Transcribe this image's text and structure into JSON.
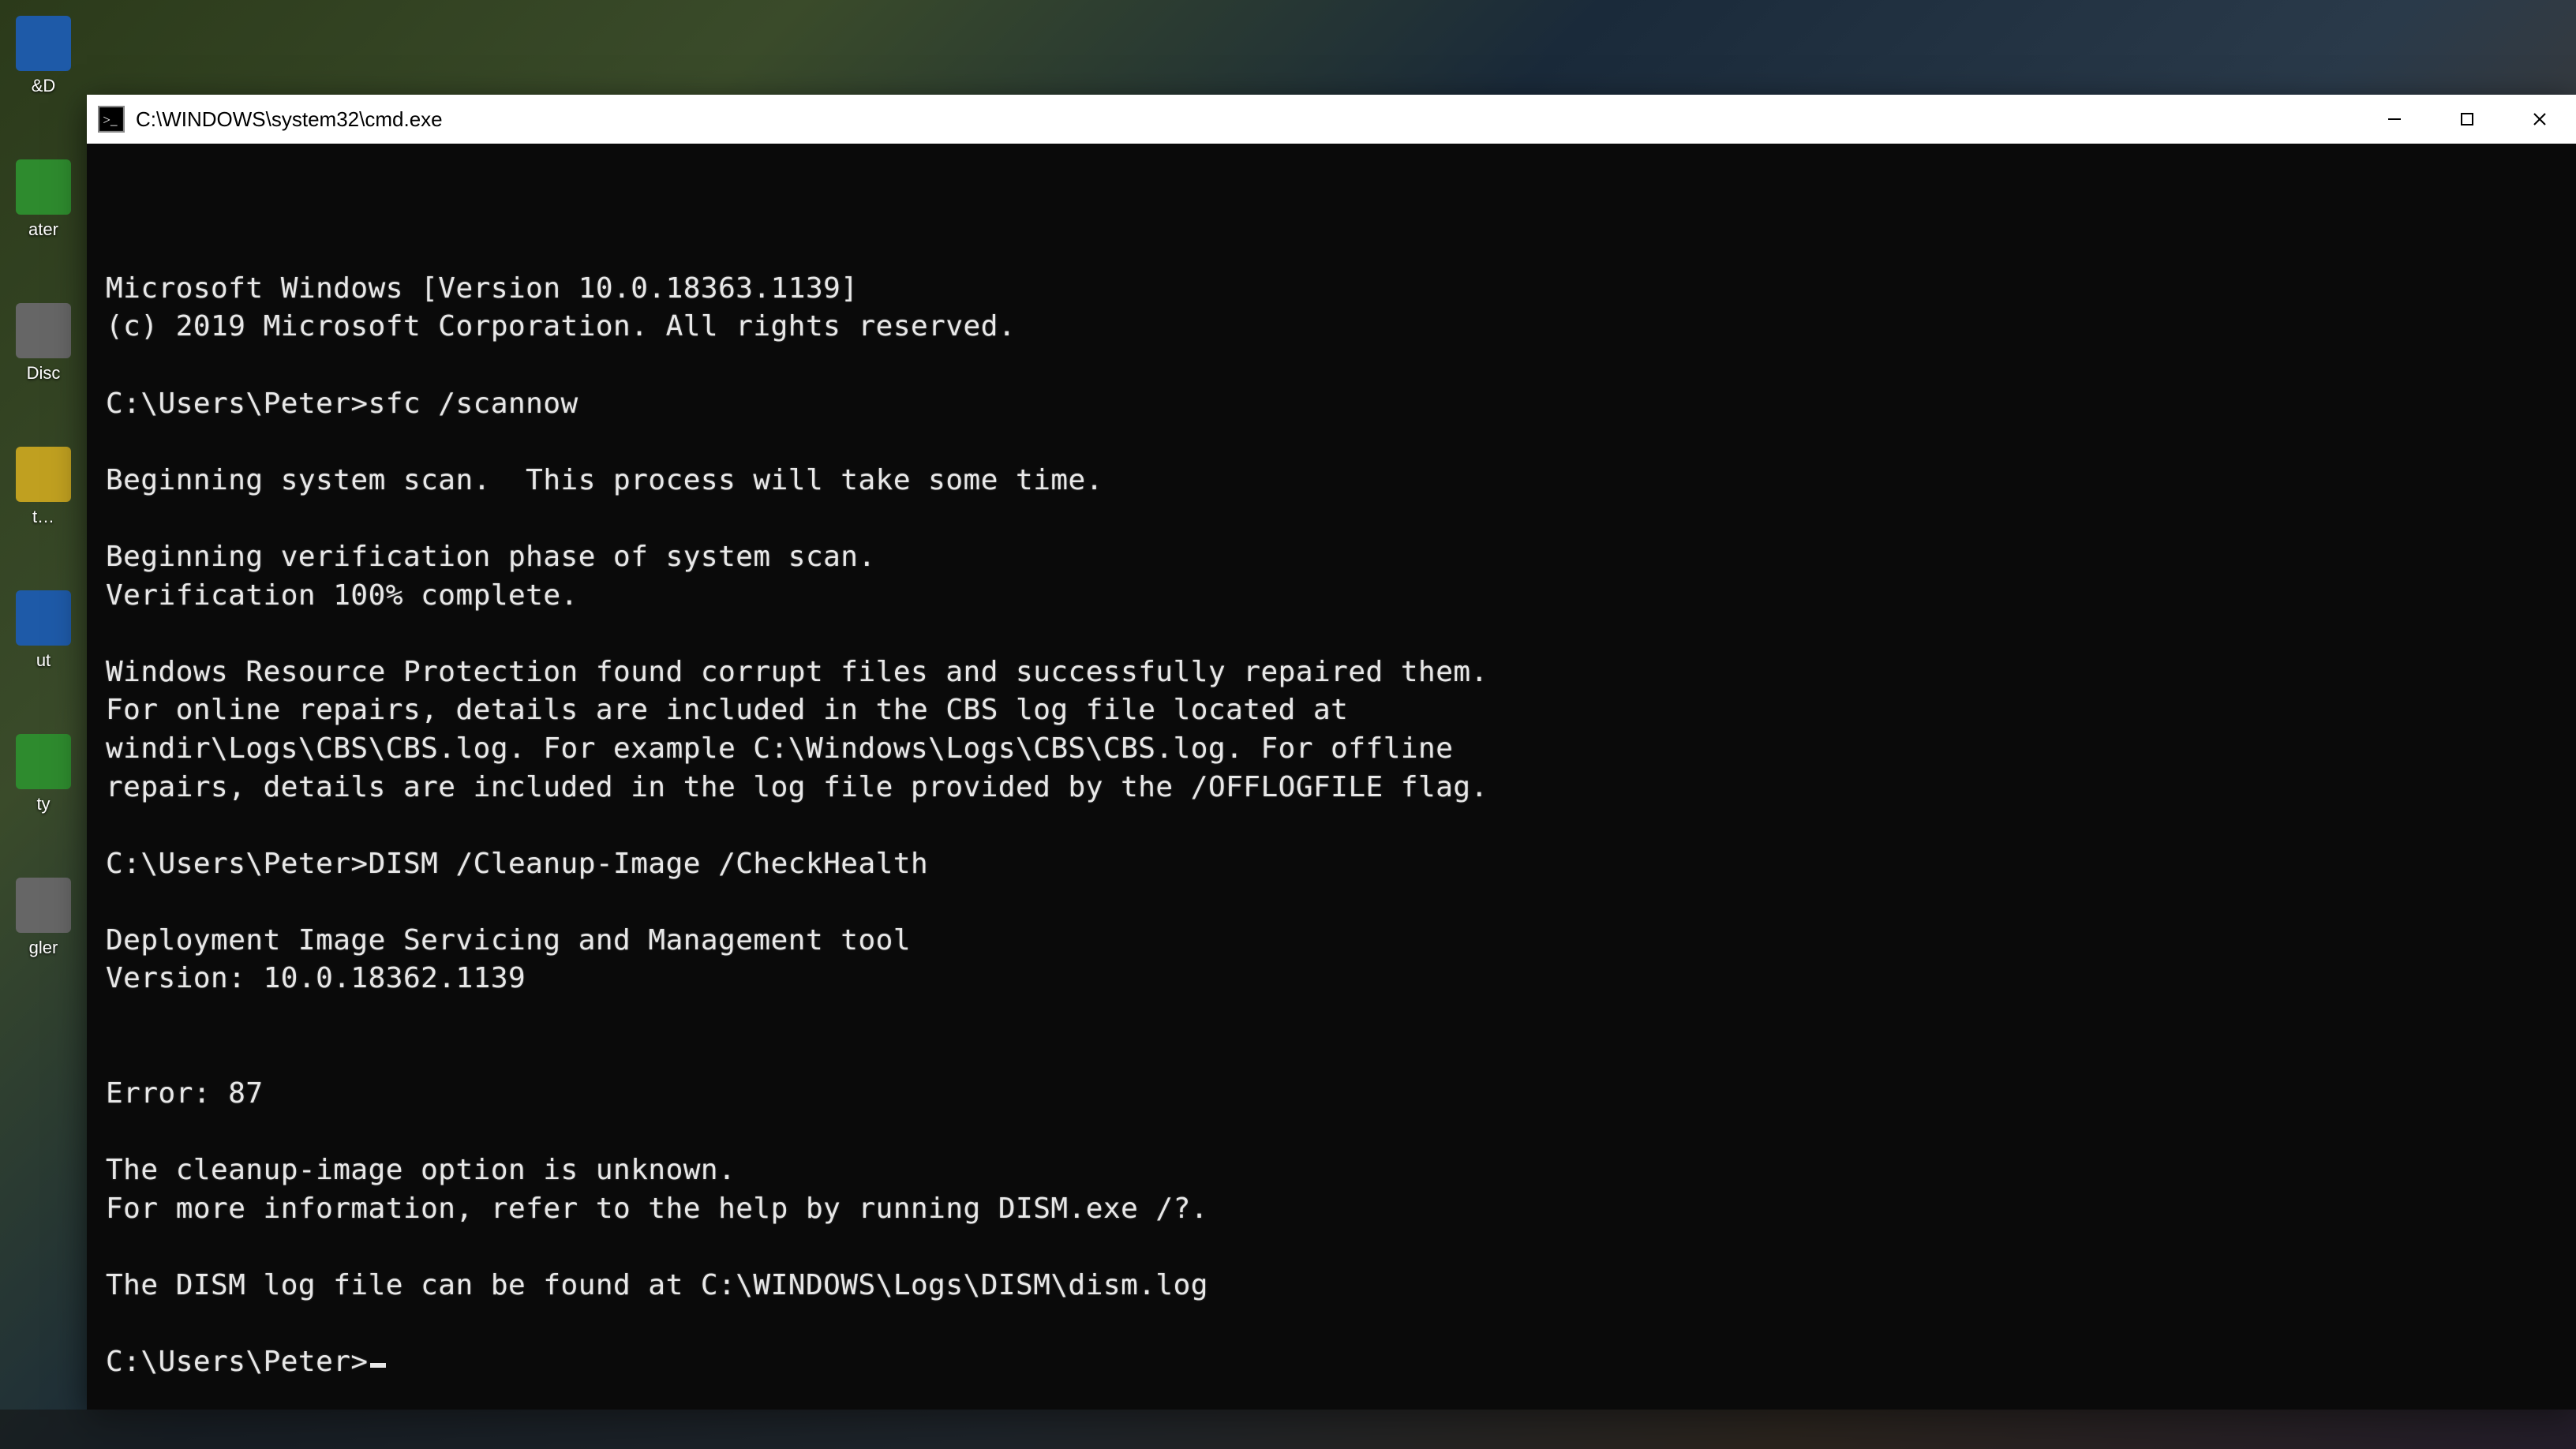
{
  "window": {
    "title": "C:\\WINDOWS\\system32\\cmd.exe"
  },
  "console": {
    "lines": [
      "Microsoft Windows [Version 10.0.18363.1139]",
      "(c) 2019 Microsoft Corporation. All rights reserved.",
      "",
      "C:\\Users\\Peter>sfc /scannow",
      "",
      "Beginning system scan.  This process will take some time.",
      "",
      "Beginning verification phase of system scan.",
      "Verification 100% complete.",
      "",
      "Windows Resource Protection found corrupt files and successfully repaired them.",
      "For online repairs, details are included in the CBS log file located at",
      "windir\\Logs\\CBS\\CBS.log. For example C:\\Windows\\Logs\\CBS\\CBS.log. For offline",
      "repairs, details are included in the log file provided by the /OFFLOGFILE flag.",
      "",
      "C:\\Users\\Peter>DISM /Cleanup-Image /CheckHealth",
      "",
      "Deployment Image Servicing and Management tool",
      "Version: 10.0.18362.1139",
      "",
      "",
      "Error: 87",
      "",
      "The cleanup-image option is unknown.",
      "For more information, refer to the help by running DISM.exe /?.",
      "",
      "The DISM log file can be found at C:\\WINDOWS\\Logs\\DISM\\dism.log",
      "",
      "C:\\Users\\Peter>"
    ],
    "prompt_has_cursor": true
  },
  "desktop": {
    "icons": [
      {
        "label": "&D",
        "color": "g-blue"
      },
      {
        "label": "ater",
        "color": "g-green"
      },
      {
        "label": "Disc",
        "color": "g-grey"
      },
      {
        "label": "t…",
        "color": "g-yellow"
      },
      {
        "label": "ut",
        "color": "g-blue"
      },
      {
        "label": "ty",
        "color": "g-green"
      },
      {
        "label": "gler",
        "color": "g-grey"
      }
    ]
  }
}
